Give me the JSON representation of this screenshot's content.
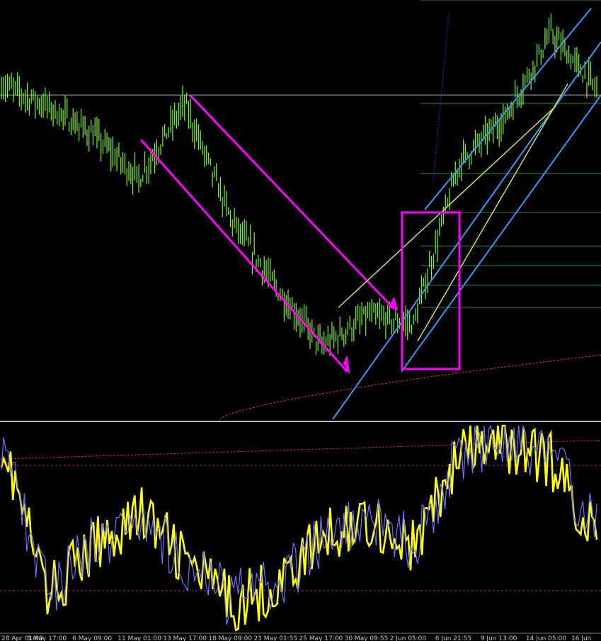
{
  "chart_data": [
    {
      "type": "line",
      "title": "",
      "style": "bar",
      "colors": {
        "background": "#000000",
        "bars": "#7CFC00",
        "price_hline": "#8fb0c8"
      },
      "x": [
        "28 Apr 01:00",
        "3 May 17:00",
        "6 May 09:00",
        "11 May 01:00",
        "13 May 17:00",
        "18 May 09:00",
        "23 May 01:55",
        "25 May 17:00",
        "30 May 09:55",
        "2 Jun 05:00",
        "6 Jun 21:55",
        "9 Jun 13:00",
        "14 Jun 05:00",
        "16 Jun"
      ],
      "series": [
        {
          "values": [
            0.7,
            0.62,
            0.52,
            0.36,
            0.63,
            0.22,
            -0.03,
            -0.24,
            -0.13,
            -0.16,
            0.42,
            0.58,
            0.88,
            0.68
          ]
        }
      ],
      "ylim": [
        -0.5,
        1.0
      ],
      "price_hline": 0.66,
      "grid": false,
      "legend": "none",
      "drawings": {
        "fib_levels": [
          1.0,
          0.63,
          0.38,
          0.24,
          0.12,
          0.05,
          -0.02,
          -0.1
        ],
        "fib_color": "#2f8a2f",
        "down_channel_color": "#ff00ff",
        "up_channel_color": "#3399ff",
        "wedge_color": "#c8e650",
        "highlight_box_color": "#ff00ff",
        "curve_color": "#d04020"
      }
    },
    {
      "type": "line",
      "title": "",
      "x": [
        "28 Apr 01:00",
        "3 May 17:00",
        "6 May 09:00",
        "11 May 01:00",
        "13 May 17:00",
        "18 May 09:00",
        "23 May 01:55",
        "25 May 17:00",
        "30 May 09:55",
        "2 Jun 05:00",
        "6 Jun 21:55",
        "9 Jun 13:00",
        "14 Jun 05:00",
        "16 Jun"
      ],
      "series": [
        {
          "values": [
            93,
            18,
            40,
            58,
            35,
            14,
            22,
            45,
            55,
            40,
            85,
            90,
            82,
            45
          ],
          "color": "#ffff00"
        },
        {
          "values": [
            92,
            20,
            42,
            56,
            34,
            16,
            22,
            44,
            54,
            42,
            86,
            92,
            84,
            48
          ],
          "color": "#7070ff"
        }
      ],
      "levels": [
        80,
        20
      ],
      "ylim": [
        0,
        100
      ],
      "grid": false,
      "legend": "none"
    }
  ]
}
